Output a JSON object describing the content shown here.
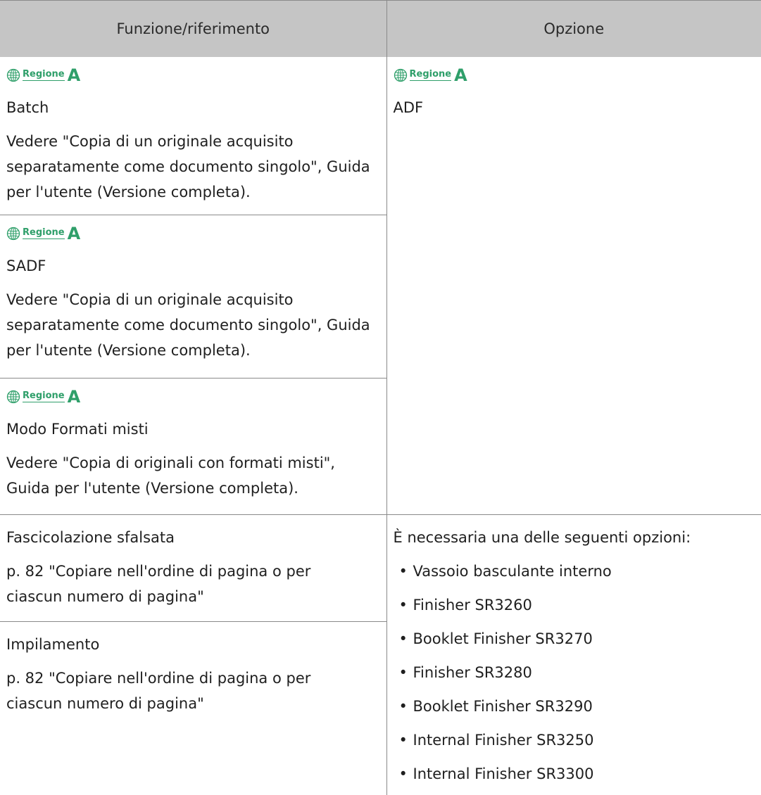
{
  "header": {
    "col1": "Funzione/riferimento",
    "col2": "Opzione"
  },
  "region": {
    "label": "Regione",
    "letter": "A"
  },
  "rows": [
    {
      "function": "Batch",
      "ref_line1": "Vedere \"Copia di un originale acquisito",
      "ref_line2": "separatamente come documento singolo\", Guida",
      "ref_line3": "per l'utente (Versione completa)."
    },
    {
      "function": "SADF",
      "ref_line1": "Vedere \"Copia di un originale acquisito",
      "ref_line2": "separatamente come documento singolo\", Guida",
      "ref_line3": "per l'utente (Versione completa)."
    },
    {
      "function": "Modo Formati misti",
      "ref_line1": "Vedere \"Copia di originali con formati misti\",",
      "ref_line2": "Guida per l'utente (Versione completa)."
    },
    {
      "function": "Fascicolazione sfalsata",
      "ref_line1": "p. 82 \"Copiare nell'ordine di pagina o per",
      "ref_line2": "ciascun numero di pagina\""
    },
    {
      "function": "Impilamento",
      "ref_line1": "p. 82 \"Copiare nell'ordine di pagina o per",
      "ref_line2": "ciascun numero di pagina\""
    }
  ],
  "option_adf": "ADF",
  "option_finishers": {
    "intro": "È necessaria una delle seguenti opzioni:",
    "items": [
      "Vassoio basculante interno",
      "Finisher SR3260",
      "Booklet Finisher SR3270",
      "Finisher SR3280",
      "Booklet Finisher SR3290",
      "Internal Finisher SR3250",
      "Internal Finisher SR3300"
    ]
  },
  "colors": {
    "region_green": "#2f9f6a",
    "header_bg": "#c5c5c5",
    "rule": "#8a8a8a"
  },
  "icons": {
    "region": "globe-icon"
  }
}
